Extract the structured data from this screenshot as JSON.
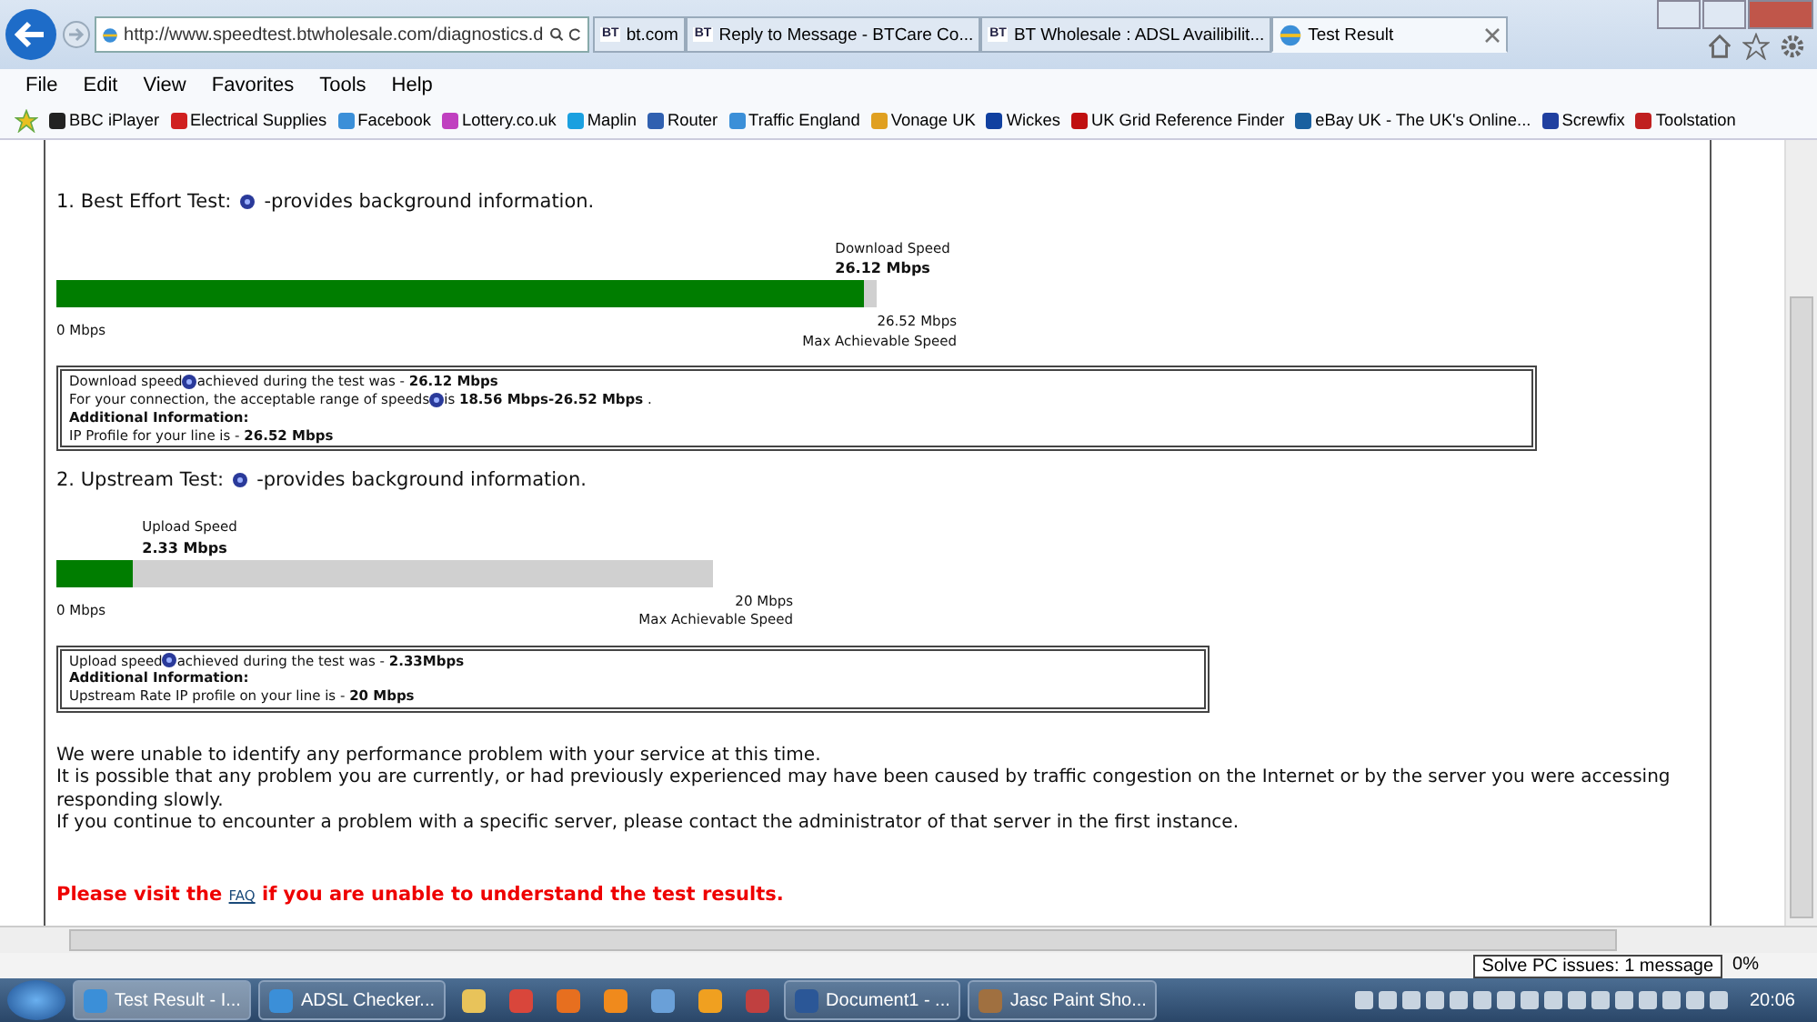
{
  "browser": {
    "address": "http://www.speedtest.btwholesale.com/diagnostics.d",
    "tabs": [
      {
        "label": "bt.com",
        "logo": "BT",
        "selected": false
      },
      {
        "label": "Reply to Message - BTCare Co...",
        "logo": "BT",
        "selected": false
      },
      {
        "label": "BT Wholesale : ADSL Availibilit...",
        "logo": "BT",
        "selected": false
      },
      {
        "label": "Test Result",
        "selected": true
      }
    ],
    "menu": [
      "File",
      "Edit",
      "View",
      "Favorites",
      "Tools",
      "Help"
    ],
    "favorites": [
      "BBC iPlayer",
      "Electrical Supplies",
      "Facebook",
      "Lottery.co.uk",
      "Maplin",
      "Router",
      "Traffic England",
      "Vonage UK",
      "Wickes",
      "UK Grid Reference Finder",
      "eBay UK - The UK's Online...",
      "Screwfix",
      "Toolstation"
    ]
  },
  "page": {
    "sections": [
      {
        "heading": "1. Best Effort Test:",
        "heading_note": "-provides background information.",
        "gauge": {
          "title": "Download Speed",
          "value": "26.12 Mbps",
          "level": 0.985,
          "min_label": "0 Mbps",
          "max_value": "26.52 Mbps",
          "max_label": "Max Achievable Speed"
        },
        "info": [
          {
            "kind": "text",
            "before": "Download speed",
            "help_icon": true,
            "after": "achieved during the test was - **26.12 Mbps**"
          },
          {
            "kind": "text",
            "before": "For your connection, the acceptable range of speeds",
            "help_icon": true,
            "after": "is **18.56 Mbps-26.52 Mbps** ."
          },
          {
            "kind": "label",
            "before": "Additional Information:",
            "help_icon": false
          },
          {
            "kind": "text",
            "before": "IP Profile for your line is - **26.52 Mbps**",
            "help_icon": false
          }
        ]
      },
      {
        "heading": "2. Upstream Test:",
        "heading_note": "-provides background information.",
        "gauge": {
          "title": "Upload Speed",
          "value": "2.33 Mbps",
          "level": 0.1165,
          "min_label": "0 Mbps",
          "max_value": "20 Mbps",
          "max_label": "Max Achievable Speed"
        },
        "info": [
          {
            "kind": "text",
            "before": "Upload speed",
            "help_icon": true,
            "after": " achieved during the test was - **2.33Mbps**"
          },
          {
            "kind": "label",
            "before": "Additional Information:",
            "help_icon": false
          },
          {
            "kind": "text",
            "before": "Upstream Rate IP profile on your line is - **20 Mbps**",
            "help_icon": false
          }
        ]
      }
    ],
    "messages": [
      "We were unable to identify any performance problem with your service at this time.",
      "It is possible that any problem you are currently, or had previously experienced may have been caused by traffic congestion on the Internet or by the server you were accessing responding slowly.",
      "If you continue to encounter a problem with a specific server, please contact the administrator of that server in the first instance."
    ],
    "notice": {
      "before": "Please visit the",
      "link": "FAQ",
      "after": "if you are unable to understand the test results."
    }
  },
  "status": {
    "zoom": "0%",
    "tooltip": "Solve PC issues: 1 message"
  },
  "taskbar": {
    "items": [
      {
        "kind": "button",
        "label": "Test Result - I...",
        "selected": true
      },
      {
        "kind": "button",
        "label": "ADSL Checker...",
        "selected": false
      },
      {
        "kind": "pin"
      },
      {
        "kind": "pin"
      },
      {
        "kind": "pin"
      },
      {
        "kind": "pin"
      },
      {
        "kind": "pin"
      },
      {
        "kind": "pin"
      },
      {
        "kind": "pin"
      },
      {
        "kind": "button",
        "label": "Document1 - ...",
        "selected": false
      },
      {
        "kind": "button",
        "label": "Jasc Paint Sho...",
        "selected": false
      }
    ],
    "clock": "20:06"
  }
}
